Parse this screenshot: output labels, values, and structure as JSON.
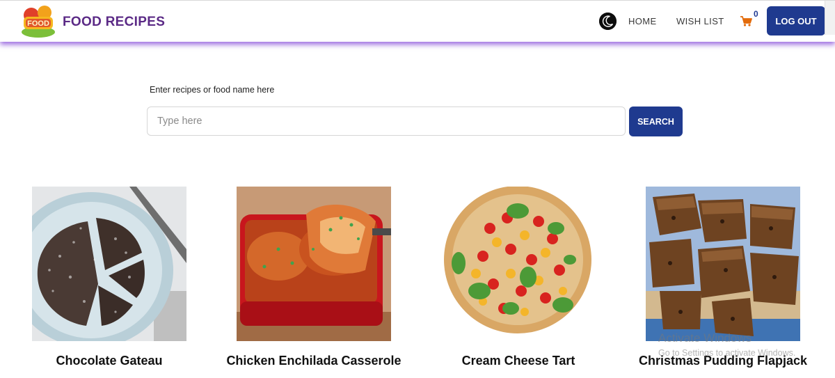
{
  "header": {
    "brand": "FOOD RECIPES",
    "nav": {
      "home": "HOME",
      "wishlist": "WISH LIST"
    },
    "cart_count": "0",
    "logout_label": "LOG OUT"
  },
  "search": {
    "label": "Enter recipes or food name here",
    "placeholder": "Type here",
    "value": "",
    "button_label": "SEARCH"
  },
  "recipes": [
    {
      "title": "Chocolate Gateau"
    },
    {
      "title": "Chicken Enchilada Casserole"
    },
    {
      "title": "Cream Cheese Tart"
    },
    {
      "title": "Christmas Pudding Flapjack"
    }
  ],
  "watermark": {
    "title": "Activate Windows",
    "subtitle": "Go to Settings to activate Windows."
  },
  "colors": {
    "brand": "#5b2a86",
    "primary": "#1f3a8f",
    "header_glow": "#7c3cd6",
    "cart": "#e36b0b"
  },
  "icons": {
    "logo": "food-logo",
    "theme": "moon-icon",
    "cart": "cart-icon"
  }
}
